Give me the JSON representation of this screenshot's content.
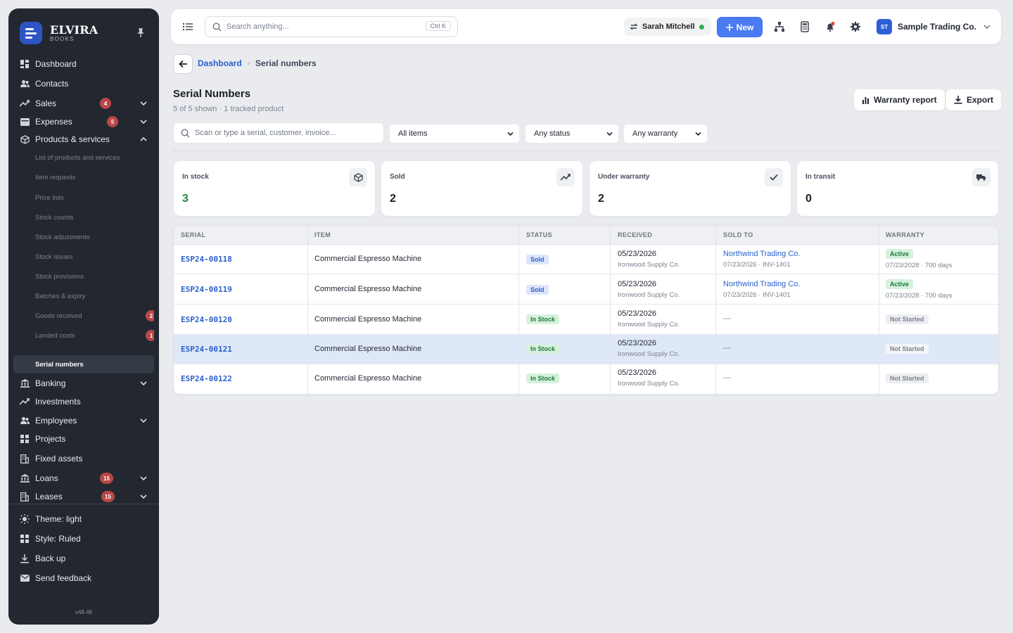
{
  "sidebar": {
    "brand": {
      "name": "ELVIRA",
      "sub": "BOOKS"
    },
    "items": [
      {
        "label": "Dashboard"
      },
      {
        "label": "Contacts"
      },
      {
        "label": "Sales",
        "badge": "4"
      },
      {
        "label": "Expenses",
        "badge": "5"
      },
      {
        "label": "Products & services"
      },
      {
        "label": "List of products and services"
      },
      {
        "label": "Item requests"
      },
      {
        "label": "Price lists"
      },
      {
        "label": "Stock counts"
      },
      {
        "label": "Stock adjustments"
      },
      {
        "label": "Stock issues"
      },
      {
        "label": "Stock provisions"
      },
      {
        "label": "Batches & expiry"
      },
      {
        "label": "Goods received",
        "badge": "2"
      },
      {
        "label": "Landed costs",
        "badge": "1"
      },
      {
        "label": "Serial numbers"
      },
      {
        "label": "Banking"
      },
      {
        "label": "Investments"
      },
      {
        "label": "Employees"
      },
      {
        "label": "Projects"
      },
      {
        "label": "Fixed assets"
      },
      {
        "label": "Loans",
        "badge": "15"
      },
      {
        "label": "Leases",
        "badge": "15"
      }
    ],
    "bottom": [
      {
        "label": "Theme: light"
      },
      {
        "label": "Style: Ruled"
      },
      {
        "label": "Back up"
      },
      {
        "label": "Send feedback"
      }
    ],
    "version": "v48.48"
  },
  "topbar": {
    "search_placeholder": "Search anything...",
    "shortcut": "Ctrl K",
    "user": "Sarah Mitchell",
    "new_label": "New",
    "company_initials": "ST",
    "company": "Sample Trading Co."
  },
  "breadcrumb": {
    "parent": "Dashboard",
    "current": "Serial numbers"
  },
  "page": {
    "title": "Serial Numbers",
    "subtitle": "5 of 5 shown · 1 tracked product",
    "warranty_report": "Warranty report",
    "export": "Export"
  },
  "filters": {
    "search_placeholder": "Scan or type a serial, customer, invoice...",
    "items": "All items",
    "status": "Any status",
    "warranty": "Any warranty"
  },
  "stats": [
    {
      "label": "In stock",
      "value": "3"
    },
    {
      "label": "Sold",
      "value": "2"
    },
    {
      "label": "Under warranty",
      "value": "2"
    },
    {
      "label": "In transit",
      "value": "0"
    }
  ],
  "table": {
    "columns": [
      "SERIAL",
      "ITEM",
      "STATUS",
      "RECEIVED",
      "SOLD TO",
      "WARRANTY"
    ],
    "rows": [
      {
        "serial": "ESP24-00118",
        "item": "Commercial Espresso Machine",
        "status": "Sold",
        "received": "05/23/2026",
        "supplier": "Ironwood Supply Co.",
        "sold_to": "Northwind Trading Co.",
        "sold_detail": "07/23/2026 · INV-1401",
        "warranty": "Active",
        "warranty_detail": "07/23/2028 · 700 days"
      },
      {
        "serial": "ESP24-00119",
        "item": "Commercial Espresso Machine",
        "status": "Sold",
        "received": "05/23/2026",
        "supplier": "Ironwood Supply Co.",
        "sold_to": "Northwind Trading Co.",
        "sold_detail": "07/23/2026 · INV-1401",
        "warranty": "Active",
        "warranty_detail": "07/23/2028 · 700 days"
      },
      {
        "serial": "ESP24-00120",
        "item": "Commercial Espresso Machine",
        "status": "In Stock",
        "received": "05/23/2026",
        "supplier": "Ironwood Supply Co.",
        "sold_to": "—",
        "warranty": "Not Started"
      },
      {
        "serial": "ESP24-00121",
        "item": "Commercial Espresso Machine",
        "status": "In Stock",
        "received": "05/23/2026",
        "supplier": "Ironwood Supply Co.",
        "sold_to": "—",
        "warranty": "Not Started"
      },
      {
        "serial": "ESP24-00122",
        "item": "Commercial Espresso Machine",
        "status": "In Stock",
        "received": "05/23/2026",
        "supplier": "Ironwood Supply Co.",
        "sold_to": "—",
        "warranty": "Not Started"
      }
    ]
  },
  "colors": {
    "accent": "#4b7bf2",
    "sidebar_bg": "#232830",
    "badge": "#b94747",
    "success": "#1d8a3c"
  }
}
